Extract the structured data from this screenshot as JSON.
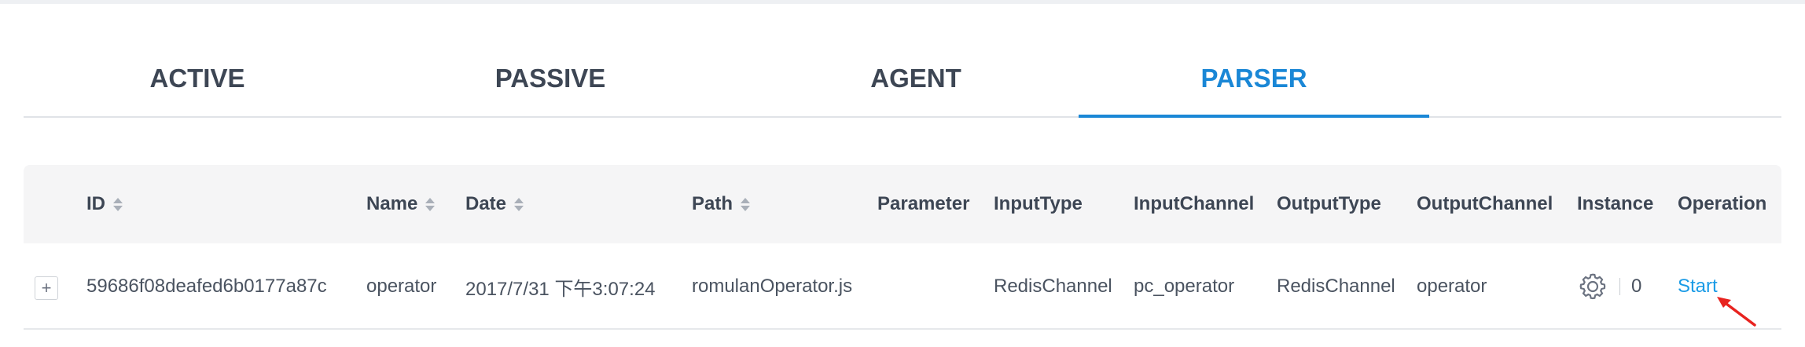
{
  "tabs": [
    {
      "label": "ACTIVE"
    },
    {
      "label": "PASSIVE"
    },
    {
      "label": "AGENT"
    },
    {
      "label": "PARSER"
    }
  ],
  "active_tab": "PARSER",
  "table": {
    "columns": [
      "ID",
      "Name",
      "Date",
      "Path",
      "Parameter",
      "InputType",
      "InputChannel",
      "OutputType",
      "OutputChannel",
      "Instance",
      "Operation"
    ],
    "sortable": [
      "ID",
      "Name",
      "Date",
      "Path"
    ],
    "rows": [
      {
        "expand": "+",
        "id": "59686f08deafed6b0177a87c",
        "name": "operator",
        "date": "2017/7/31 下午3:07:24",
        "path": "romulanOperator.js",
        "parameter": "",
        "input_type": "RedisChannel",
        "input_channel": "pc_operator",
        "output_type": "RedisChannel",
        "output_channel": "operator",
        "instance_count": "0",
        "operation": "Start"
      }
    ]
  },
  "colors": {
    "accent": "#1a87d6",
    "link": "#1a9be6",
    "annotation_arrow": "#e8231f"
  },
  "icons": {
    "instance": "gear-icon",
    "annotation": "red-arrow-icon"
  }
}
